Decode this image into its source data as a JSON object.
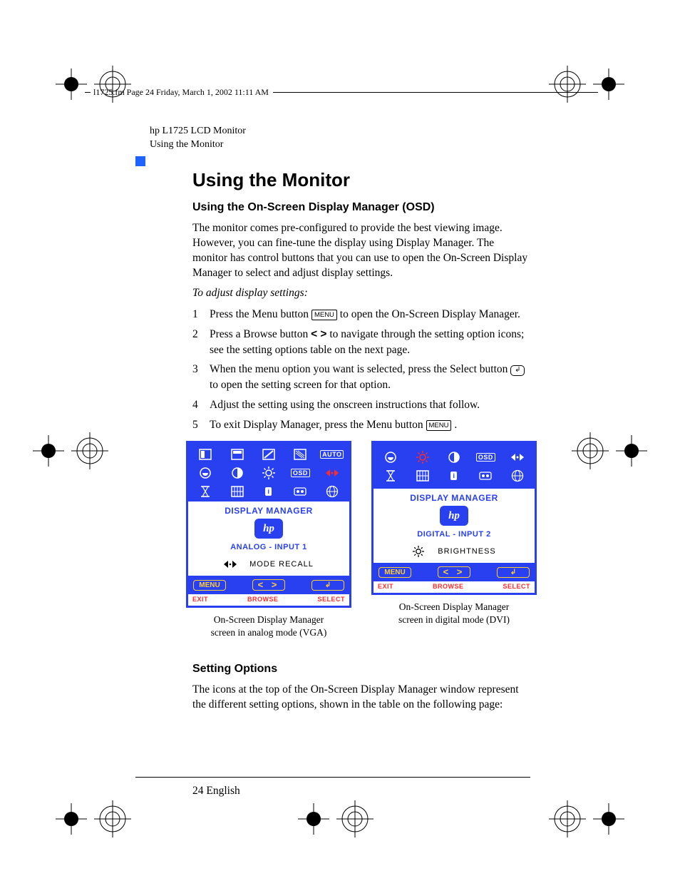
{
  "header_slug": "l1725.fm  Page 24  Friday, March 1, 2002  11:11 AM",
  "running_head_1": "hp L1725 LCD Monitor",
  "running_head_2": "Using the Monitor",
  "title": "Using the Monitor",
  "subtitle_osd": "Using the On-Screen Display Manager (OSD)",
  "intro": "The monitor comes pre-configured to provide the best viewing image. However, you can fine-tune the display using Display Manager. The monitor has control buttons that you can use to open the On-Screen Display Manager to select and adjust display settings.",
  "to_adjust": "To adjust display settings:",
  "menu_label": "MENU",
  "steps": {
    "s1a": "Press the Menu button ",
    "s1b": " to open the On-Screen Display Manager.",
    "s2a": "Press a Browse button ",
    "s2b": " to navigate through the setting option icons; see the setting options table on the next page.",
    "s3a": "When the menu option you want is selected, press the Select button ",
    "s3b": " to open the setting screen for that option.",
    "s4": "Adjust the setting using the onscreen instructions that follow.",
    "s5a": "To exit Display Manager, press the Menu button ",
    "s5b": " ."
  },
  "osd": {
    "title": "DISPLAY MANAGER",
    "hp": "hp",
    "analog_label": "ANALOG - INPUT 1",
    "digital_label": "DIGITAL - INPUT 2",
    "mode_recall": "MODE RECALL",
    "brightness": "BRIGHTNESS",
    "btn_menu": "MENU",
    "foot_exit": "EXIT",
    "foot_browse": "BROWSE",
    "foot_select": "SELECT",
    "auto_pill": "AUTO",
    "osd_pill": "OSD",
    "info_pill": "i"
  },
  "caption_analog_1": "On-Screen Display Manager",
  "caption_analog_2": "screen in analog mode (VGA)",
  "caption_digital_1": "On-Screen Display Manager",
  "caption_digital_2": "screen in digital mode (DVI)",
  "subtitle_settings": "Setting Options",
  "settings_text": "The icons at the top of the On-Screen Display Manager window represent the different setting options, shown in the table on the following page:",
  "page_footer": "24 English",
  "browse_arrows": "<  >",
  "select_glyph": "↲"
}
